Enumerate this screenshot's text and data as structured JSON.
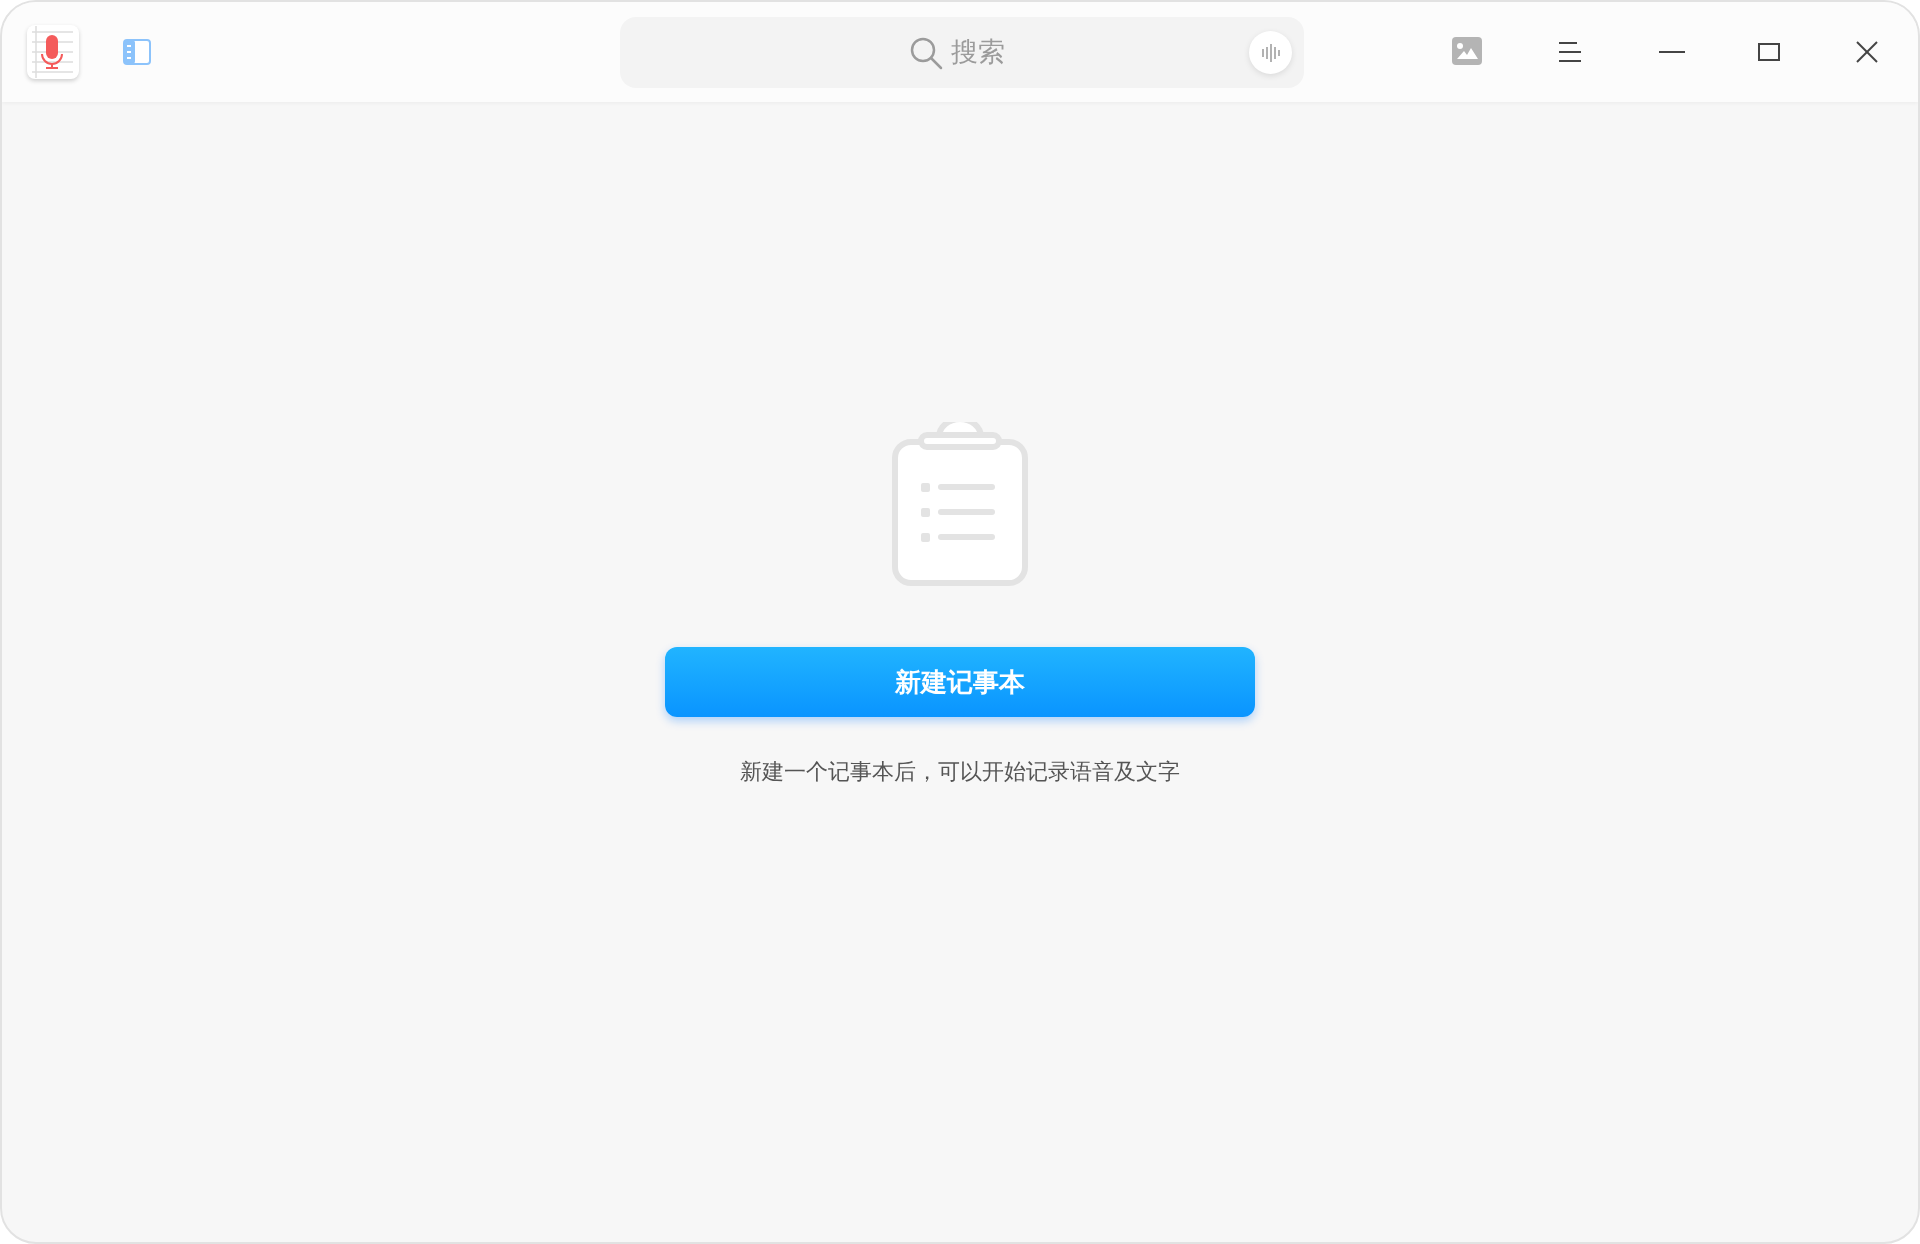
{
  "search": {
    "placeholder": "搜索"
  },
  "empty_state": {
    "button": "新建记事本",
    "hint": "新建一个记事本后，可以开始记录语音及文字"
  }
}
